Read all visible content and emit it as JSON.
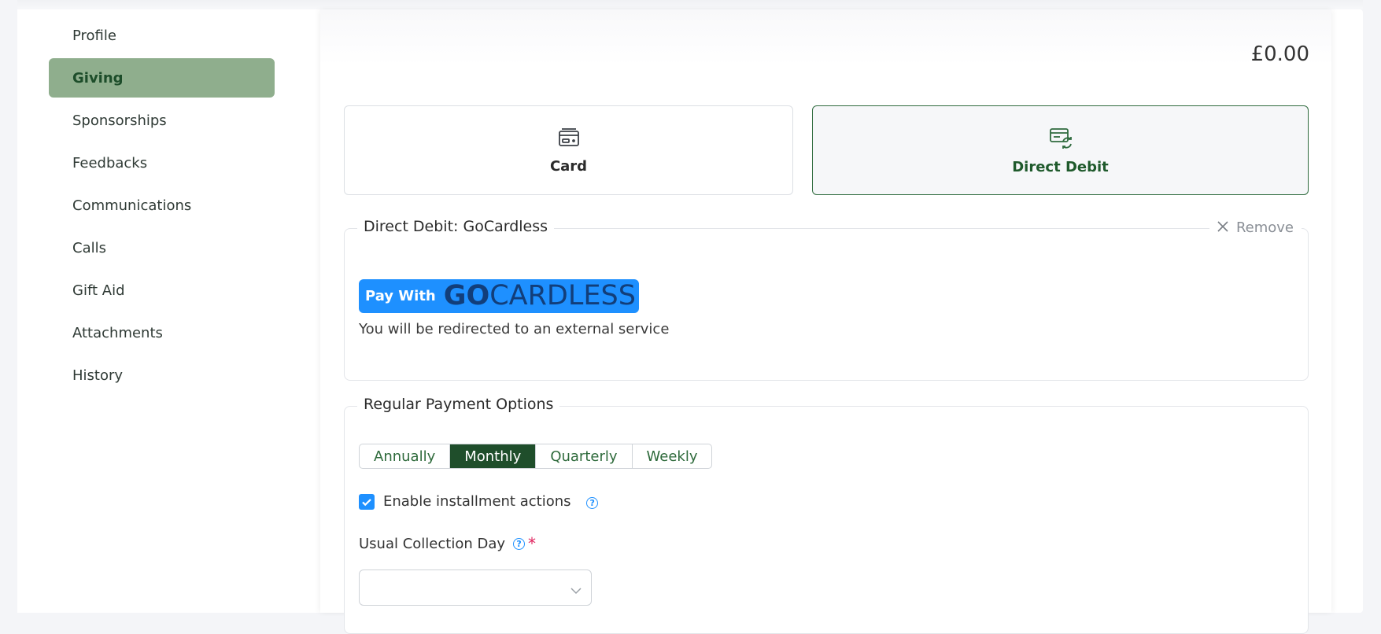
{
  "sidebar": {
    "items": [
      {
        "label": "Profile"
      },
      {
        "label": "Giving"
      },
      {
        "label": "Sponsorships"
      },
      {
        "label": "Feedbacks"
      },
      {
        "label": "Communications"
      },
      {
        "label": "Calls"
      },
      {
        "label": "Gift Aid"
      },
      {
        "label": "Attachments"
      },
      {
        "label": "History"
      }
    ],
    "active": "Giving"
  },
  "main": {
    "amount": "£0.00",
    "payment_methods": [
      {
        "label": "Card",
        "icon": "credit-card-icon"
      },
      {
        "label": "Direct Debit",
        "icon": "recurring-payment-icon",
        "selected": true
      }
    ],
    "direct_debit": {
      "legend": "Direct Debit: GoCardless",
      "remove_label": "Remove",
      "pay_with": "Pay With",
      "logo_bold": "GO",
      "logo_rest": "CARDLESS",
      "redirect_note": "You will be redirected to an external service"
    },
    "regular_payment": {
      "legend": "Regular Payment Options",
      "frequencies": [
        "Annually",
        "Monthly",
        "Quarterly",
        "Weekly"
      ],
      "selected_frequency": "Monthly",
      "enable_installments_label": "Enable installment actions",
      "enable_installments_checked": true,
      "collection_day_label": "Usual Collection Day",
      "required_mark": "*",
      "help_glyph": "?",
      "collection_day_value": ""
    }
  },
  "colors": {
    "active_nav_bg": "#8fae8d",
    "primary_green": "#1f4e2b",
    "gocardless_blue": "#1e90ff"
  }
}
